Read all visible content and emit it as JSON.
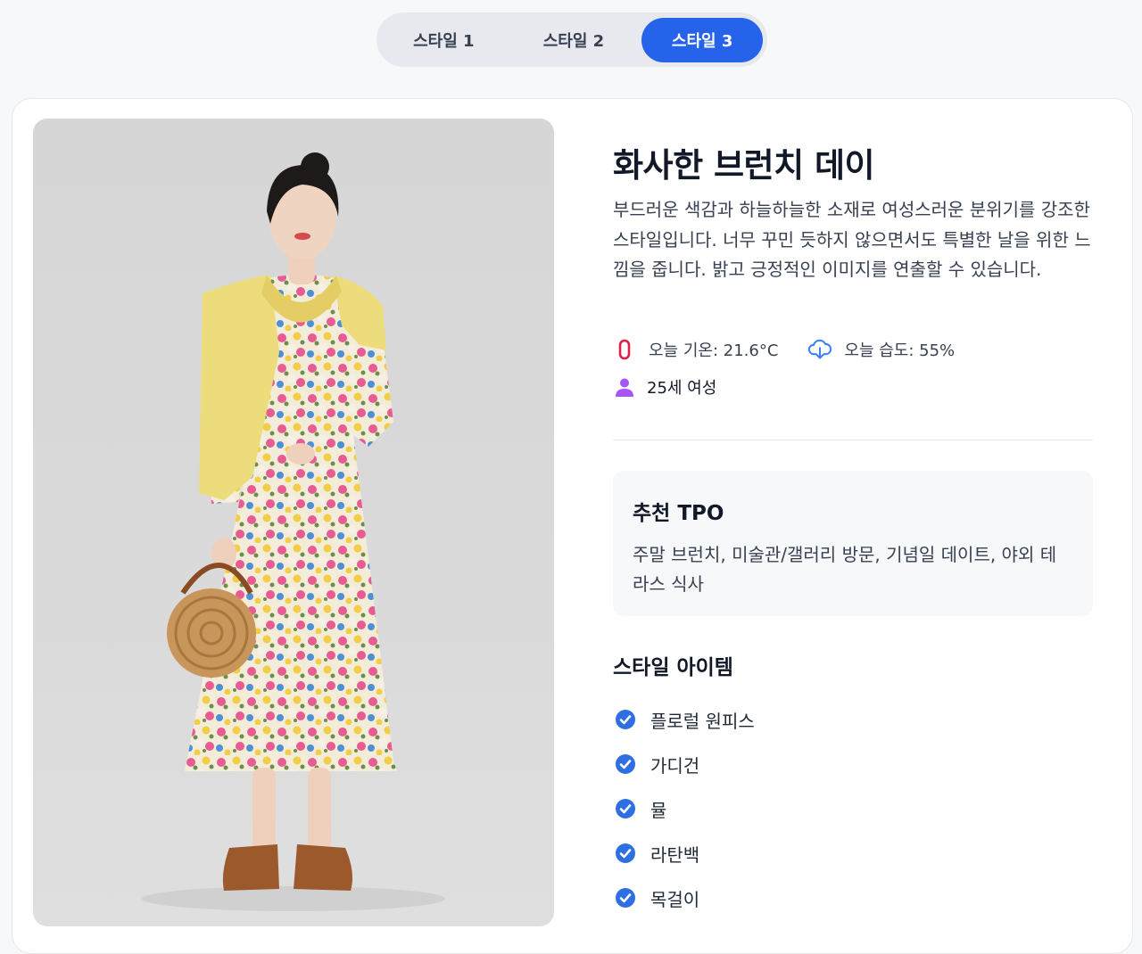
{
  "tabs": [
    {
      "label": "스타일 1",
      "active": false
    },
    {
      "label": "스타일 2",
      "active": false
    },
    {
      "label": "스타일 3",
      "active": true
    }
  ],
  "style": {
    "title": "화사한 브런치 데이",
    "description": "부드러운 색감과 하늘하늘한 소재로 여성스러운 분위기를 강조한 스타일입니다. 너무 꾸민 듯하지 않으면서도 특별한 날을 위한 느낌을 줍니다. 밝고 긍정적인 이미지를 연출할 수 있습니다.",
    "temperature": "오늘 기온: 21.6°C",
    "humidity": "오늘 습도: 55%",
    "person": "25세 여성"
  },
  "tpo": {
    "title": "추천 TPO",
    "text": "주말 브런치, 미술관/갤러리 방문, 기념일 데이트, 야외 테라스 식사"
  },
  "items": {
    "title": "스타일 아이템",
    "list": [
      "플로럴 원피스",
      "가디건",
      "뮬",
      "라탄백",
      "목걸이"
    ]
  },
  "icons": {
    "temperature": "thermometer-icon",
    "humidity": "cloud-download-icon",
    "person": "person-icon",
    "check": "check-circle-icon"
  },
  "colors": {
    "accent": "#2563eb",
    "temperature_icon": "#e11d48",
    "humidity_icon": "#3b82f6",
    "person_icon": "#a855f7",
    "check_icon": "#2f6fe4"
  }
}
